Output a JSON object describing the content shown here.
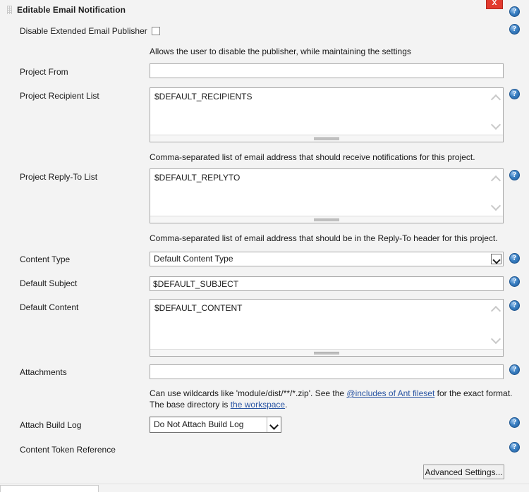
{
  "panel": {
    "title": "Editable Email Notification",
    "close_label": "X"
  },
  "fields": {
    "disable_publisher": {
      "label": "Disable Extended Email Publisher",
      "checked": false,
      "hint": "Allows the user to disable the publisher, while maintaining the settings"
    },
    "project_from": {
      "label": "Project From",
      "value": "",
      "placeholder": ""
    },
    "project_recipient_list": {
      "label": "Project Recipient List",
      "value": "$DEFAULT_RECIPIENTS",
      "hint": "Comma-separated list of email address that should receive notifications for this project."
    },
    "project_reply_to_list": {
      "label": "Project Reply-To List",
      "value": "$DEFAULT_REPLYTO",
      "hint": "Comma-separated list of email address that should be in the Reply-To header for this project."
    },
    "content_type": {
      "label": "Content Type",
      "value": "Default Content Type"
    },
    "default_subject": {
      "label": "Default Subject",
      "value": "$DEFAULT_SUBJECT"
    },
    "default_content": {
      "label": "Default Content",
      "value": "$DEFAULT_CONTENT"
    },
    "attachments": {
      "label": "Attachments",
      "value": "",
      "hint_line1_pre": "Can use wildcards like 'module/dist/**/*.zip'. See the ",
      "hint_link1": "@includes of Ant fileset",
      "hint_line1_post": " for the exact format.",
      "hint_line2_pre": "The base directory is ",
      "hint_link2": "the workspace",
      "hint_line2_post": "."
    },
    "attach_build_log": {
      "label": "Attach Build Log",
      "value": "Do Not Attach Build Log"
    },
    "content_token_reference": {
      "label": "Content Token Reference"
    }
  },
  "buttons": {
    "advanced_settings": "Advanced Settings..."
  },
  "icons": {
    "help": "help-icon",
    "close": "close-icon",
    "drag": "drag-handle-icon"
  }
}
